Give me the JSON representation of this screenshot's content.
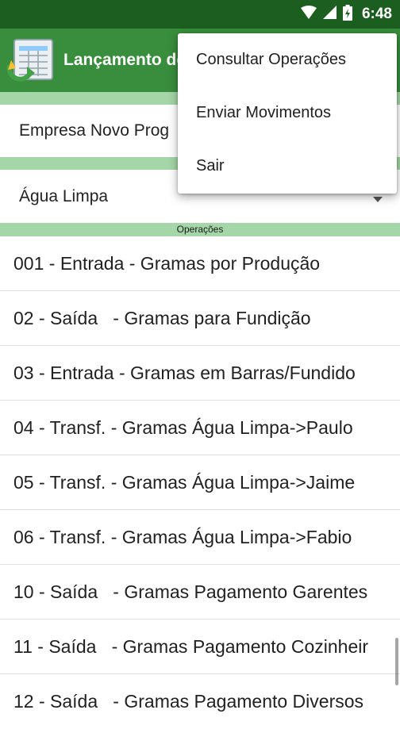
{
  "status_bar": {
    "time": "6:48",
    "icons": [
      "wifi-icon",
      "signal-icon",
      "battery-charging-icon"
    ]
  },
  "app_bar": {
    "title": "Lançamento de",
    "icon": "spreadsheet-sync-icon"
  },
  "company_selector": {
    "value": "Empresa Novo Prog"
  },
  "location_selector": {
    "value": "Água Limpa",
    "icon": "dropdown-arrow-icon"
  },
  "operations": {
    "section_label": "Operações",
    "items": [
      "001 - Entrada - Gramas por Produção",
      "02 - Saída   - Gramas para Fundição",
      "03 - Entrada - Gramas em Barras/Fundido",
      "04 - Transf. - Gramas Água Limpa->Paulo",
      "05 - Transf. - Gramas Água Limpa->Jaime",
      "06 - Transf. - Gramas Água Limpa->Fabio",
      "10 - Saída   - Gramas Pagamento Garentes",
      "11 - Saída   - Gramas Pagamento Cozinheir",
      "12 - Saída   - Gramas Pagamento Diversos"
    ]
  },
  "overflow_menu": {
    "items": [
      "Consultar Operações",
      "Enviar Movimentos",
      "Sair"
    ]
  },
  "colors": {
    "status_bar": "#1b5e20",
    "app_bar": "#388e3c",
    "section_strip": "#a5d6a7"
  }
}
